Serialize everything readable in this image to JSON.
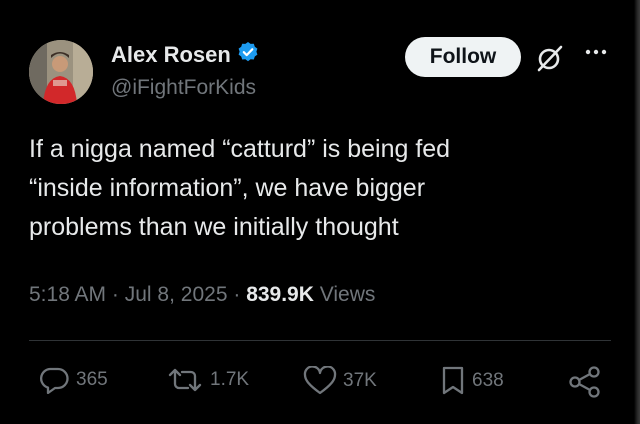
{
  "author": {
    "name": "Alex Rosen",
    "handle": "@iFightForKids",
    "verified": true,
    "verified_color": "#1d9bf0"
  },
  "header": {
    "follow_label": "Follow",
    "icons": [
      "grok-icon",
      "more-icon"
    ]
  },
  "tweet": {
    "lines": [
      "If a nigga named “catturd” is being fed",
      "“inside information”, we have bigger",
      "problems than we initially thought"
    ]
  },
  "meta": {
    "time": "5:18 AM",
    "separator": "·",
    "date": "Jul 8, 2025",
    "views_count": "839.9K",
    "views_label": "Views"
  },
  "actions": {
    "replies": "365",
    "reposts": "1.7K",
    "likes": "37K",
    "bookmarks": "638"
  },
  "colors": {
    "background": "#000000",
    "text": "#e7e9ea",
    "secondary": "#71767b",
    "divider": "#2f3336",
    "follow_bg": "#eff3f4"
  }
}
